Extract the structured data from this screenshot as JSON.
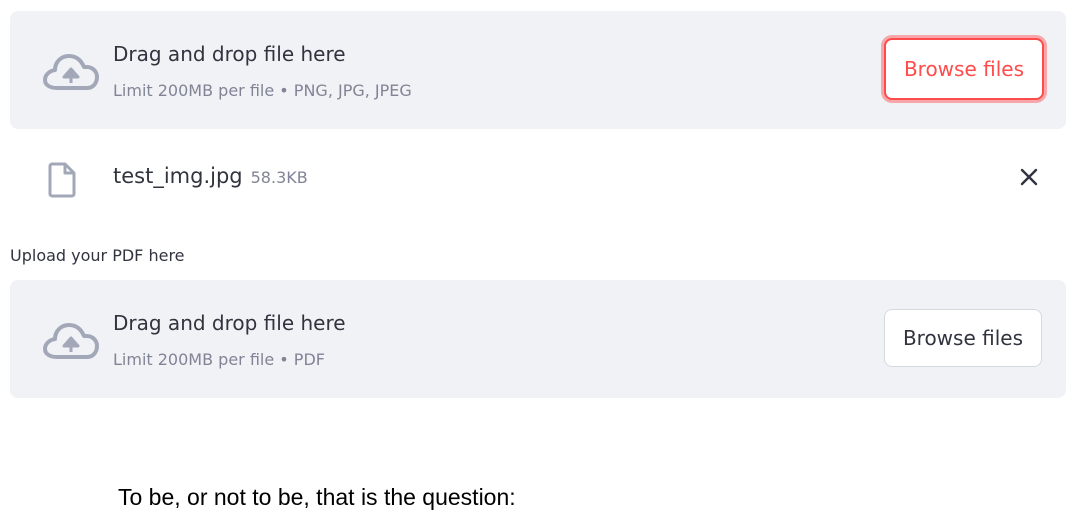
{
  "image_uploader": {
    "title": "Drag and drop file here",
    "limit_text": "Limit 200MB per file • PNG, JPG, JPEG",
    "browse_label": "Browse files",
    "icon": "cloud-upload-icon"
  },
  "uploaded_file": {
    "name": "test_img.jpg",
    "size": "58.3KB",
    "icon": "file-icon",
    "remove_icon": "close-icon"
  },
  "pdf_uploader": {
    "label": "Upload your PDF here",
    "title": "Drag and drop file here",
    "limit_text": "Limit 200MB per file • PDF",
    "browse_label": "Browse files",
    "icon": "cloud-upload-icon"
  },
  "image_preview": {
    "text": "To be, or not to be, that is the question:"
  },
  "colors": {
    "dropzone_bg": "#f0f2f6",
    "accent": "#ff4b4b",
    "muted_text": "#808495",
    "icon": "#a3a8b8"
  }
}
